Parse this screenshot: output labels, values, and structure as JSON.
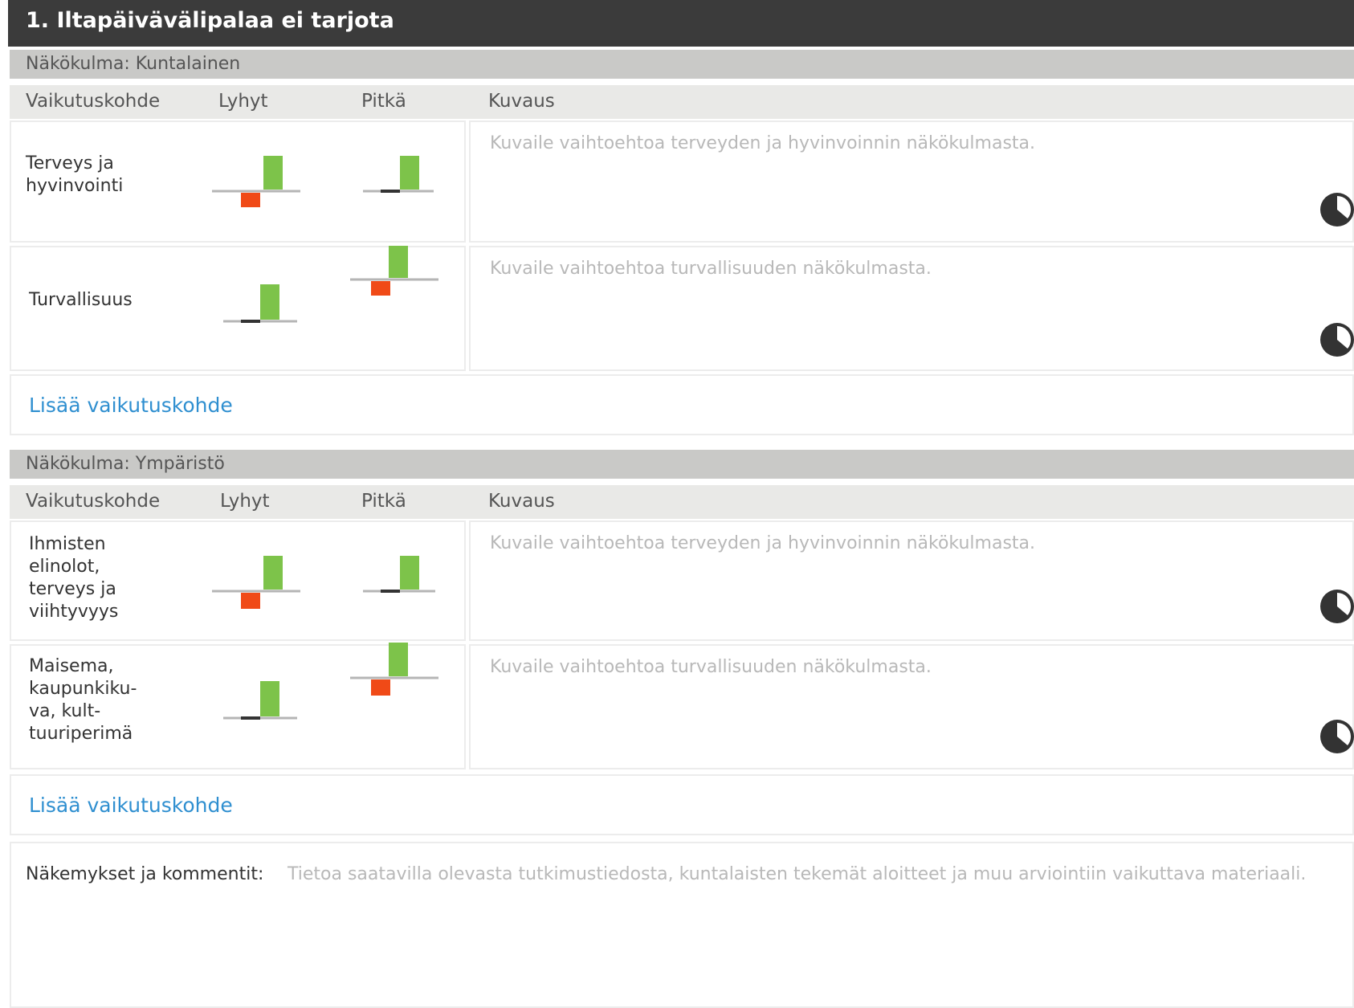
{
  "header": {
    "title": "1. Iltapäivävälipalaa ei tarjota"
  },
  "columns": {
    "target": "Vaikutuskohde",
    "short": "Lyhyt",
    "long": "Pitkä",
    "description": "Kuvaus"
  },
  "colors": {
    "positive": "#7dc34a",
    "negative": "#f04a17",
    "baseline": "#b5b5b5",
    "neutral": "#333333",
    "link": "#2f8fd0"
  },
  "sections": [
    {
      "title": "Näkökulma: Kuntalainen",
      "rows": [
        {
          "label": "Terveys ja hyvinvointi",
          "description_placeholder": "Kuvaile  vaihtoehtoa terveyden ja hyvinvoinnin näkökulmasta.",
          "short": {
            "positive": true,
            "negative": true
          },
          "long": {
            "positive": true,
            "negative": false
          }
        },
        {
          "label": "Turvallisuus",
          "description_placeholder": "Kuvaile  vaihtoehtoa turvallisuuden näkökulmasta.",
          "short": {
            "positive": true,
            "negative": false
          },
          "long": {
            "positive": true,
            "negative": true
          }
        }
      ],
      "add_link": "Lisää vaikutuskohde"
    },
    {
      "title": "Näkökulma: Ympäristö",
      "rows": [
        {
          "label": "Ihmisten elinolot, terveys ja viihtyvyys",
          "description_placeholder": "Kuvaile  vaihtoehtoa terveyden ja hyvinvoinnin näkökulmasta.",
          "short": {
            "positive": true,
            "negative": true
          },
          "long": {
            "positive": true,
            "negative": false
          }
        },
        {
          "label": "Maisema, kaupunkiku-va, kult-tuuriperimä",
          "description_placeholder": "Kuvaile  vaihtoehtoa turvallisuuden näkökulmasta.",
          "short": {
            "positive": true,
            "negative": false
          },
          "long": {
            "positive": true,
            "negative": true
          }
        }
      ],
      "add_link": "Lisää vaikutuskohde"
    }
  ],
  "comments": {
    "label": "Näkemykset ja kommentit:",
    "placeholder": "Tietoa saatavilla olevasta tutkimustiedosta, kuntalaisten tekemät aloitteet ja muu arviointiin vaikuttava materiaali."
  }
}
